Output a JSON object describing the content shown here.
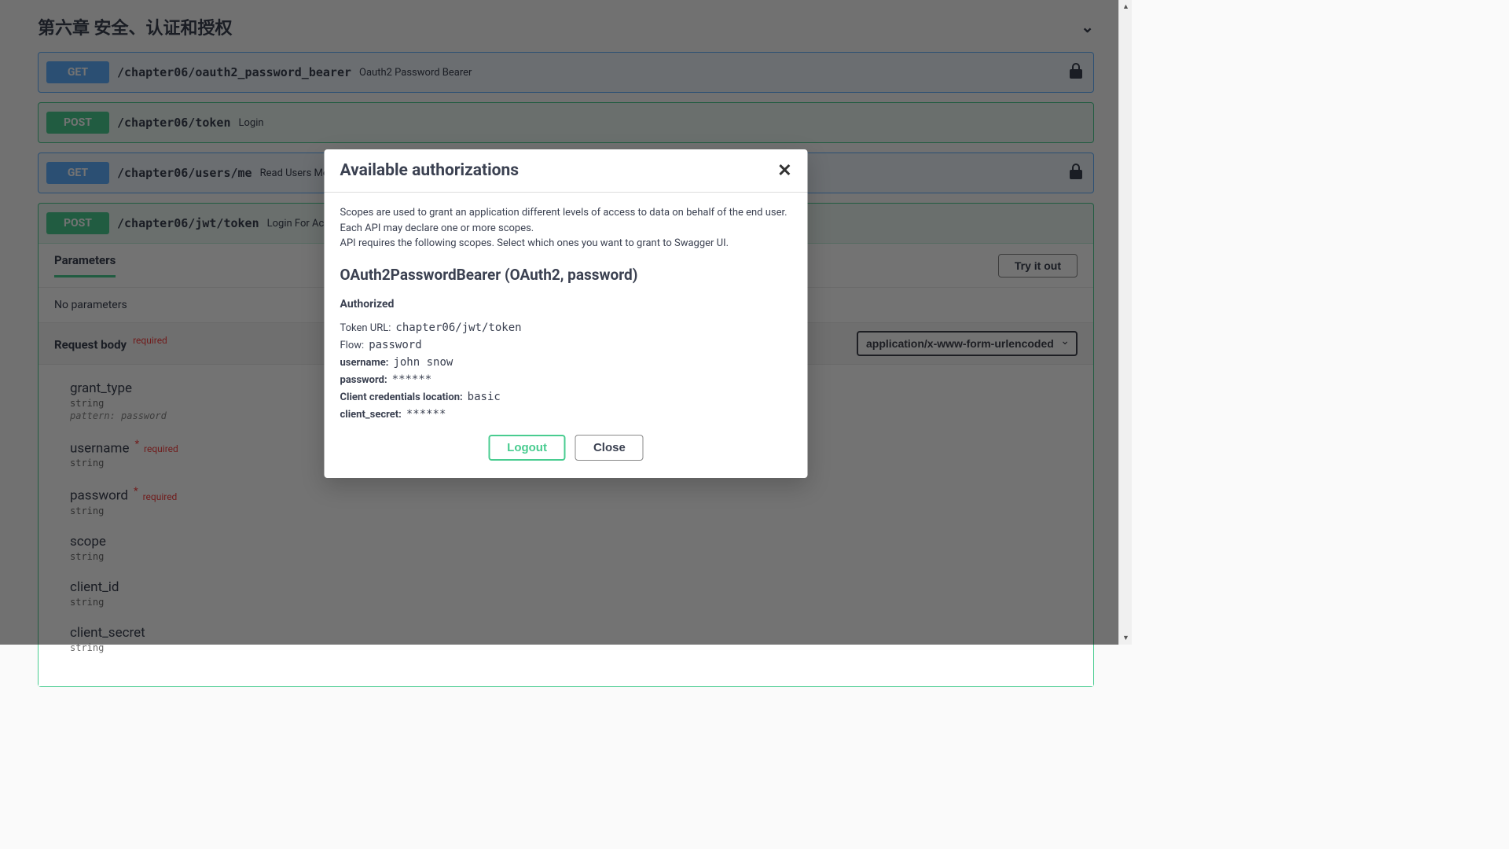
{
  "section_title": "第六章 安全、认证和授权",
  "endpoints": [
    {
      "method": "GET",
      "path": "/chapter06/oauth2_password_bearer",
      "desc": "Oauth2 Password Bearer",
      "lock": true
    },
    {
      "method": "POST",
      "path": "/chapter06/token",
      "desc": "Login",
      "lock": false
    },
    {
      "method": "GET",
      "path": "/chapter06/users/me",
      "desc": "Read Users Me",
      "lock": true
    },
    {
      "method": "POST",
      "path": "/chapter06/jwt/token",
      "desc": "Login For Ac...",
      "lock": false
    }
  ],
  "parameters_tab": "Parameters",
  "try_it_out": "Try it out",
  "no_parameters": "No parameters",
  "request_body_label": "Request body",
  "required_label": "required",
  "content_type": "application/x-www-form-urlencoded",
  "fields": [
    {
      "name": "grant_type",
      "type": "string",
      "pattern": "pattern: password",
      "required": false
    },
    {
      "name": "username",
      "type": "string",
      "required": true
    },
    {
      "name": "password",
      "type": "string",
      "required": true
    },
    {
      "name": "scope",
      "type": "string",
      "required": false
    },
    {
      "name": "client_id",
      "type": "string",
      "required": false
    },
    {
      "name": "client_secret",
      "type": "string",
      "required": false
    }
  ],
  "modal": {
    "title": "Available authorizations",
    "scope_line1": "Scopes are used to grant an application different levels of access to data on behalf of the end user. Each API may declare one or more scopes.",
    "scope_line2": "API requires the following scopes. Select which ones you want to grant to Swagger UI.",
    "auth_name": "OAuth2PasswordBearer (OAuth2, password)",
    "authorized": "Authorized",
    "token_url_label": "Token URL:",
    "token_url": "chapter06/jwt/token",
    "flow_label": "Flow:",
    "flow": "password",
    "username_label": "username:",
    "username": "john snow",
    "password_label": "password:",
    "password": "******",
    "cred_loc_label": "Client credentials location:",
    "cred_loc": "basic",
    "client_secret_label": "client_secret:",
    "client_secret": "******",
    "logout": "Logout",
    "close": "Close"
  },
  "req_star": "*",
  "req_text": "required"
}
